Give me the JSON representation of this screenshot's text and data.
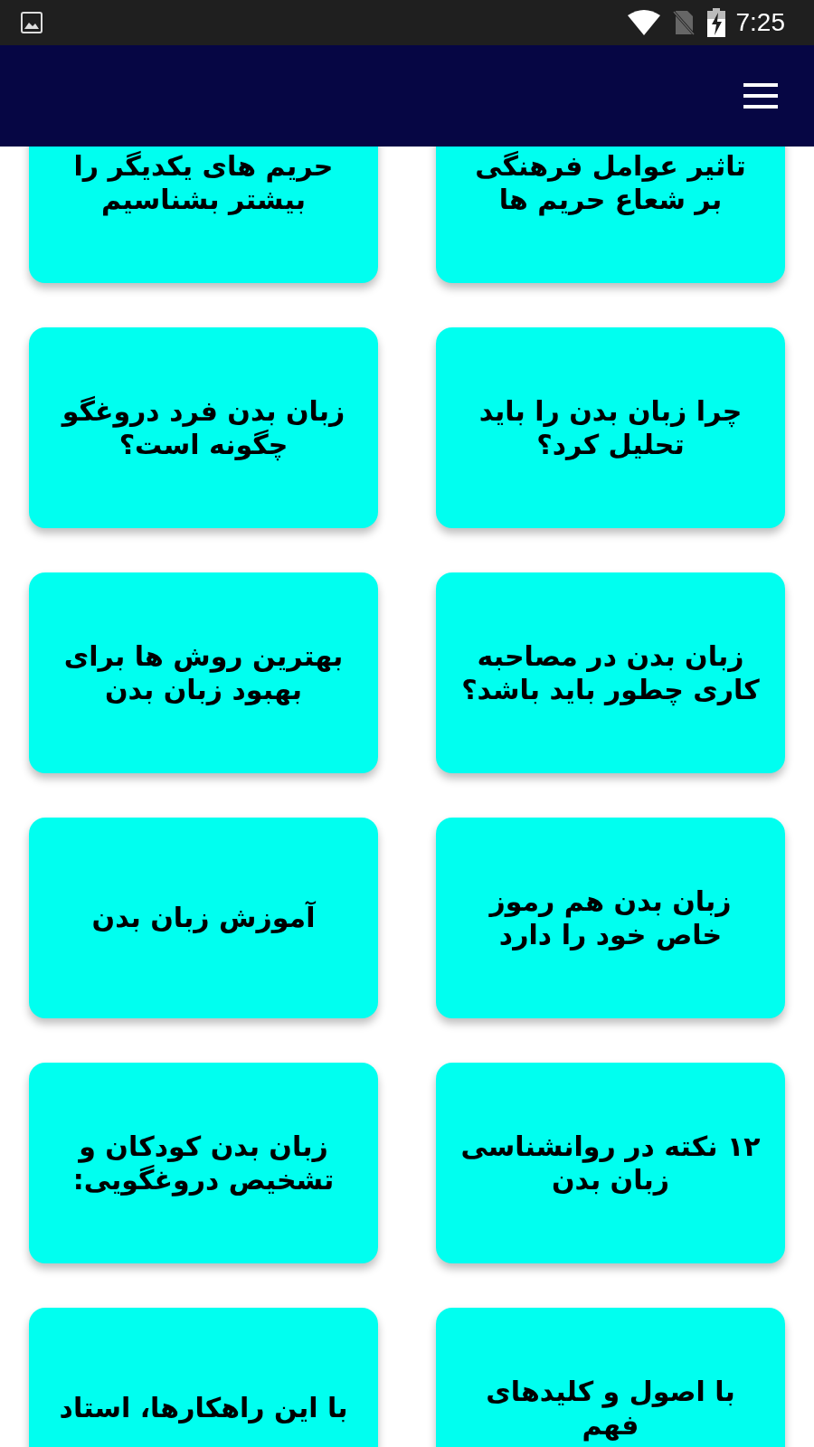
{
  "status_bar": {
    "time": "7:25"
  },
  "cards": [
    {
      "title": "تاثیر عوامل فرهنگی بر شعاع حریم ها"
    },
    {
      "title": "حریم های یکدیگر را بیشتر بشناسیم"
    },
    {
      "title": "چرا زبان بدن را باید تحلیل کرد؟"
    },
    {
      "title": "زبان بدن فرد دروغگو چگونه است؟"
    },
    {
      "title": "زبان بدن در مصاحبه کاری چطور باید باشد؟"
    },
    {
      "title": "بهترین روش ها برای بهبود زبان بدن"
    },
    {
      "title": "زبان بدن هم رموز خاص خود را دارد"
    },
    {
      "title": "آموزش زبان بدن"
    },
    {
      "title": "۱۲ نکته در روانشناسی زبان بدن"
    },
    {
      "title": "زبان بدن کودکان و تشخیص دروغگویی:"
    },
    {
      "title": "با اصول و کلیدهای فهم"
    },
    {
      "title": "با این راهکارها، استاد"
    }
  ]
}
